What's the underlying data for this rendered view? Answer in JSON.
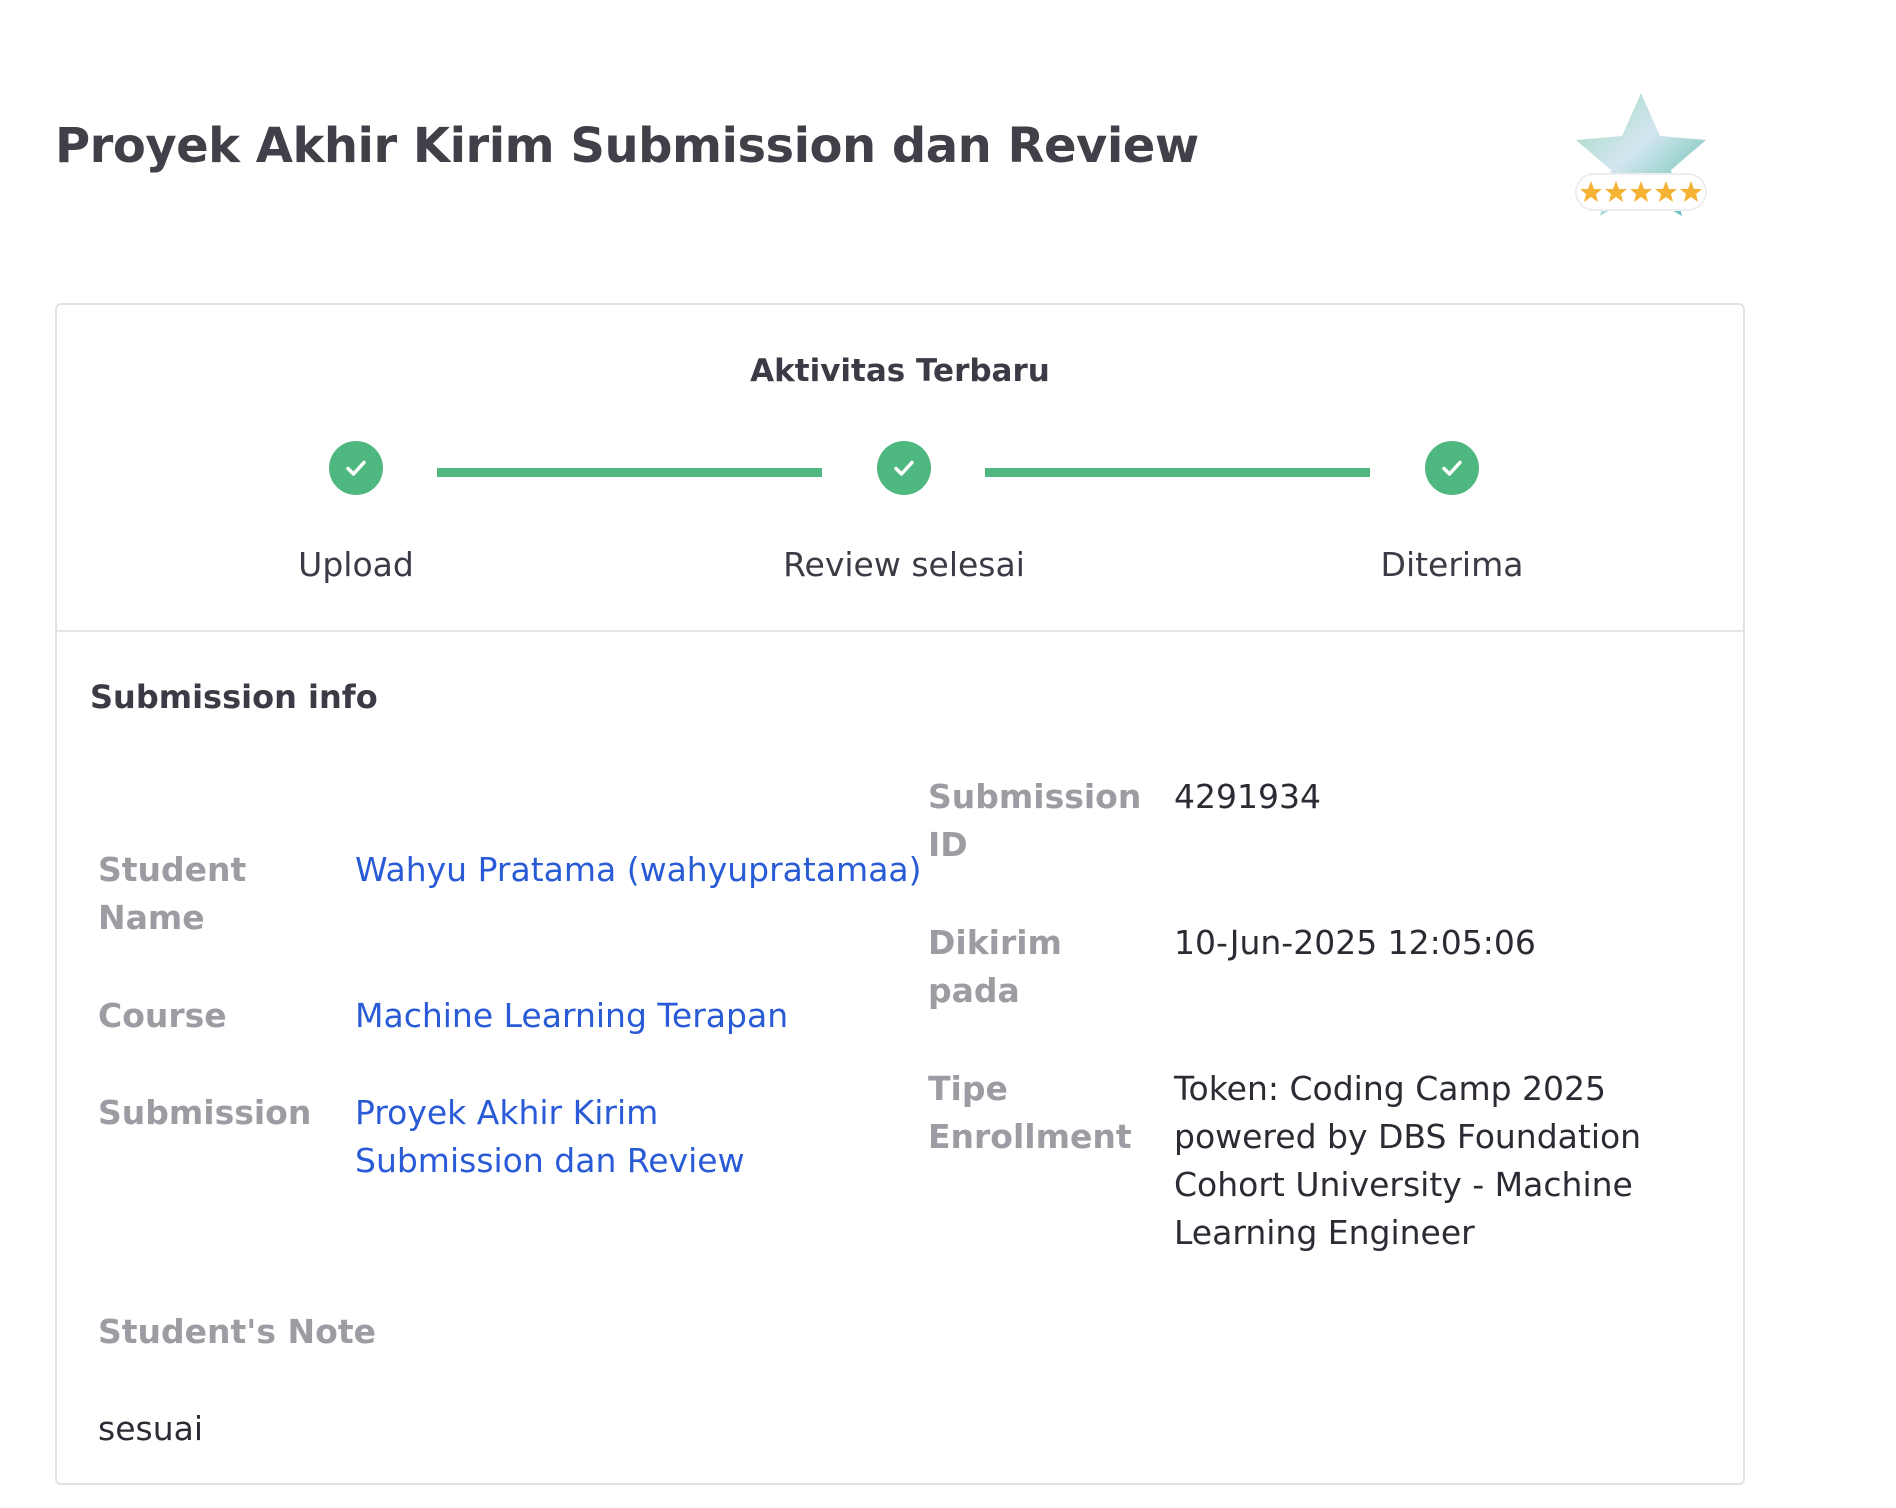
{
  "page": {
    "title": "Proyek Akhir Kirim Submission dan Review",
    "badge_icon": "five-star-rating-badge"
  },
  "activity": {
    "title": "Aktivitas Terbaru",
    "steps": [
      {
        "label": "Upload",
        "status": "done"
      },
      {
        "label": "Review selesai",
        "status": "done"
      },
      {
        "label": "Diterima",
        "status": "done"
      }
    ],
    "accent_color": "#4fb880"
  },
  "submission_info": {
    "title": "Submission info",
    "student_name_label": "Student Name",
    "student_name_value": "Wahyu Pratama (wahyupratamaa)",
    "course_label": "Course",
    "course_value": "Machine Learning Terapan",
    "submission_label": "Submission",
    "submission_value": "Proyek Akhir Kirim Submission dan Review",
    "submission_id_label": "Submission ID",
    "submission_id_value": "4291934",
    "sent_label": "Dikirim pada",
    "sent_value": "10-Jun-2025 12:05:06",
    "enrollment_label": "Tipe Enrollment",
    "enrollment_value": "Token: Coding Camp 2025 powered by DBS Foundation Cohort University - Machine Learning Engineer",
    "note_label": "Student's Note",
    "note_value": "sesuai",
    "link_color": "#2a5bd7"
  }
}
